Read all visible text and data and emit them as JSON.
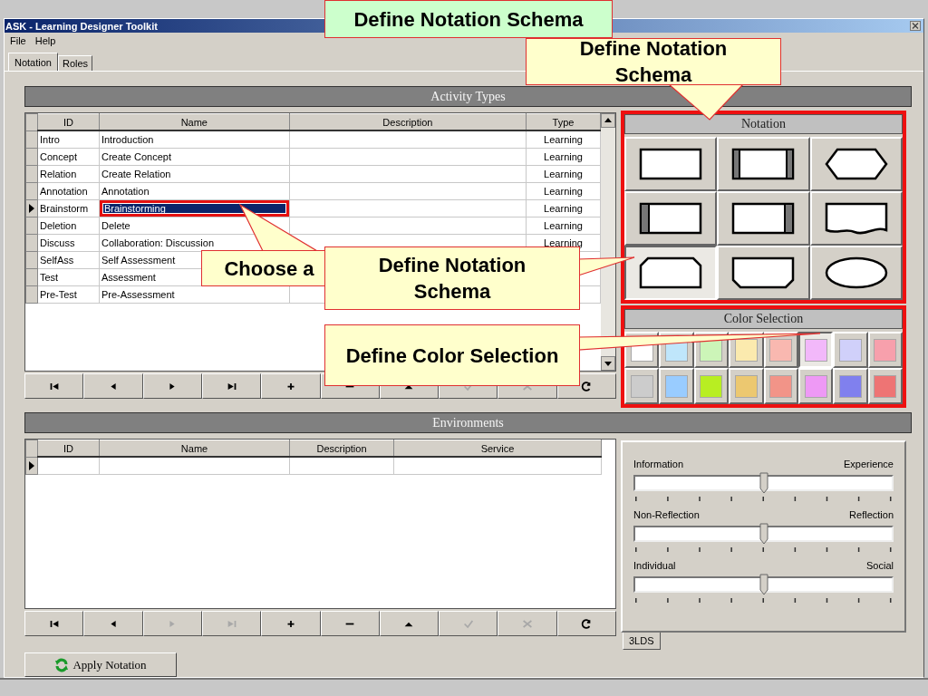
{
  "window": {
    "title": "ASK - Learning Designer Toolkit"
  },
  "menu": [
    "File",
    "Help"
  ],
  "tabs": [
    {
      "label": "Notation",
      "selected": true
    },
    {
      "label": "Roles",
      "selected": false
    }
  ],
  "activity_types": {
    "title": "Activity Types",
    "columns": [
      "ID",
      "Name",
      "Description",
      "Type"
    ],
    "rows": [
      {
        "id": "Intro",
        "name": "Introduction",
        "type": "Learning",
        "selected": false,
        "highlighted": false
      },
      {
        "id": "Concept",
        "name": "Create Concept",
        "type": "Learning",
        "selected": false,
        "highlighted": false
      },
      {
        "id": "Relation",
        "name": "Create Relation",
        "type": "Learning",
        "selected": false,
        "highlighted": false
      },
      {
        "id": "Annotation",
        "name": "Annotation",
        "type": "Learning",
        "selected": false,
        "highlighted": false
      },
      {
        "id": "Brainstorm",
        "name": "Brainstorming",
        "type": "Learning",
        "selected": true,
        "highlighted": true
      },
      {
        "id": "Deletion",
        "name": "Delete",
        "type": "Learning",
        "selected": false,
        "highlighted": false
      },
      {
        "id": "Discuss",
        "name": "Collaboration: Discussion",
        "type": "Learning",
        "selected": false,
        "highlighted": false
      },
      {
        "id": "SelfAss",
        "name": "Self Assessment",
        "selected": false,
        "highlighted": false
      },
      {
        "id": "Test",
        "name": "Assessment",
        "selected": false,
        "highlighted": false
      },
      {
        "id": "Pre-Test",
        "name": "Pre-Assessment",
        "selected": false,
        "highlighted": false
      }
    ]
  },
  "activity_nav": [
    {
      "kind": "first",
      "disabled": false
    },
    {
      "kind": "prev",
      "disabled": false
    },
    {
      "kind": "next",
      "disabled": false
    },
    {
      "kind": "last",
      "disabled": false
    },
    {
      "kind": "add",
      "disabled": false
    },
    {
      "kind": "delete",
      "disabled": false
    },
    {
      "kind": "up",
      "disabled": false
    },
    {
      "kind": "post",
      "disabled": true
    },
    {
      "kind": "cancel",
      "disabled": true
    },
    {
      "kind": "refresh",
      "disabled": false
    }
  ],
  "notation": {
    "title": "Notation",
    "highlighted": true,
    "shapes": [
      {
        "kind": "rect",
        "selected": false
      },
      {
        "kind": "both-bars",
        "selected": false
      },
      {
        "kind": "hexagon",
        "selected": false
      },
      {
        "kind": "left-bar",
        "selected": false
      },
      {
        "kind": "right-bar",
        "selected": false
      },
      {
        "kind": "wave",
        "selected": false
      },
      {
        "kind": "cut-top",
        "selected": true
      },
      {
        "kind": "cut-bottom",
        "selected": false
      },
      {
        "kind": "ellipse",
        "selected": false
      }
    ]
  },
  "color_selection": {
    "title": "Color Selection",
    "highlighted": true,
    "swatches": [
      {
        "color": "#ffffff",
        "selected": false
      },
      {
        "color": "#bfe6fb",
        "selected": false
      },
      {
        "color": "#ccf5b8",
        "selected": false
      },
      {
        "color": "#fbeaae",
        "selected": false
      },
      {
        "color": "#f9b8b0",
        "selected": false
      },
      {
        "color": "#f2b8fa",
        "selected": true
      },
      {
        "color": "#d0d0fa",
        "selected": false
      },
      {
        "color": "#f7a0ac",
        "selected": false
      },
      {
        "color": "#cccccc",
        "selected": false
      },
      {
        "color": "#99ccff",
        "selected": false
      },
      {
        "color": "#b8ee22",
        "selected": false
      },
      {
        "color": "#ecc870",
        "selected": false
      },
      {
        "color": "#f29488",
        "selected": false
      },
      {
        "color": "#ee99f5",
        "selected": false
      },
      {
        "color": "#8080ee",
        "selected": false
      },
      {
        "color": "#ee7474",
        "selected": false
      }
    ]
  },
  "environments": {
    "title": "Environments",
    "columns": [
      "ID",
      "Name",
      "Description",
      "Service"
    ],
    "rows": [
      {
        "selected": true
      }
    ]
  },
  "environment_nav": [
    {
      "kind": "first",
      "disabled": false
    },
    {
      "kind": "prev",
      "disabled": false
    },
    {
      "kind": "next",
      "disabled": true
    },
    {
      "kind": "last",
      "disabled": true
    },
    {
      "kind": "add",
      "disabled": false
    },
    {
      "kind": "delete",
      "disabled": false
    },
    {
      "kind": "up",
      "disabled": false
    },
    {
      "kind": "post",
      "disabled": true
    },
    {
      "kind": "cancel",
      "disabled": true
    },
    {
      "kind": "refresh",
      "disabled": false
    }
  ],
  "apply_button": "Apply Notation",
  "sliders": [
    {
      "left": "Information",
      "right": "Experience",
      "level": 0.5
    },
    {
      "left": "Non-Reflection",
      "right": "Reflection",
      "level": 0.5
    },
    {
      "left": "Individual",
      "right": "Social",
      "level": 0.5
    }
  ],
  "side_tabs": [
    {
      "label": "3LDS",
      "selected": true
    }
  ],
  "callouts": [
    {
      "kind": "banner",
      "text": "Define Notation Schema"
    },
    {
      "kind": "note",
      "text": "Define Notation Schema"
    },
    {
      "kind": "note",
      "text": "Choose a"
    },
    {
      "kind": "note",
      "text": "Define Notation Schema"
    },
    {
      "kind": "note",
      "text": "Define Color Selection"
    }
  ]
}
